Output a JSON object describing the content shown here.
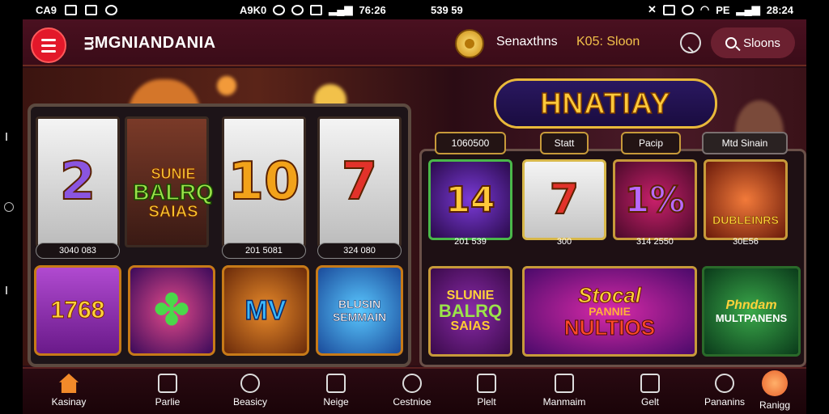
{
  "status_bar": {
    "left_carrier": "CA9",
    "left_time": "A9K0",
    "left_clock": "76:26",
    "mid_text": "539 59",
    "right_pct": "PE",
    "right_clock": "28:24"
  },
  "header": {
    "brand": "ᴟMGNIANDANIA",
    "balance_label": "Senaxthns",
    "balance_value": "K05: Sloon",
    "search_label": "Sloons"
  },
  "hero": {
    "title": "HNATIAY"
  },
  "left_machine": {
    "reels": [
      {
        "symbol": "2",
        "label": "3040 083"
      },
      {
        "title_top": "SUNIE",
        "title_mid": "BALRQ",
        "title_bot": "SAIAS"
      },
      {
        "symbol": "10",
        "label": "201 5081"
      },
      {
        "symbol": "7",
        "label": "324 080"
      }
    ],
    "tiles": [
      {
        "text": "1768"
      },
      {
        "text": ""
      },
      {
        "text": "MV"
      },
      {
        "text": "BLUSIN SEMMAIN"
      }
    ]
  },
  "right_panel": {
    "tabs": [
      {
        "label": "1060500"
      },
      {
        "label": "Statt"
      },
      {
        "label": "Pacip"
      },
      {
        "label": "Mtd Sinain"
      }
    ],
    "tiles": [
      {
        "symbol": "14",
        "label": "201 539"
      },
      {
        "symbol": "7",
        "label": "300"
      },
      {
        "symbol": "1%",
        "label": "314 2550"
      },
      {
        "text": "DUBLEINRS",
        "label": "30E56"
      }
    ],
    "bottom_tiles": [
      {
        "top": "SLUNIE",
        "mid": "BALRQ",
        "bot": "SAIAS"
      },
      {
        "top": "Stocal",
        "mid": "PANNIE",
        "bot": "NULTIOS"
      },
      {
        "top": "Phndam",
        "bot": "MULTPANENS"
      }
    ]
  },
  "bottom_nav": [
    {
      "label": "Kasinay",
      "icon": "home-icon"
    },
    {
      "label": "Parlie",
      "icon": "card-icon"
    },
    {
      "label": "Beasicy",
      "icon": "ban-icon"
    },
    {
      "label": "Neige",
      "icon": "tools-icon"
    },
    {
      "label": "Cestnioe",
      "icon": "coin-icon"
    },
    {
      "label": "Plelt",
      "icon": "monitor-icon"
    },
    {
      "label": "Manmaim",
      "icon": "bank-icon"
    },
    {
      "label": "Gelt",
      "icon": "house-icon"
    },
    {
      "label": "Pananins",
      "icon": "grid-icon"
    },
    {
      "label": "Ranigg",
      "icon": "profile-icon"
    }
  ],
  "colors": {
    "accent_red": "#e3182a",
    "gold": "#f2c14a",
    "frame": "#2a0d14",
    "nav_active": "#f28a2a"
  }
}
